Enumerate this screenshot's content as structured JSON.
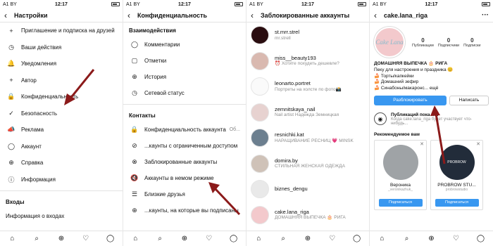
{
  "status": {
    "carrier": "A1 BY",
    "time": "12:17"
  },
  "screen1": {
    "title": "Настройки",
    "items": [
      {
        "icon": "+",
        "label": "Приглашение и подписка на друзей"
      },
      {
        "icon": "◷",
        "label": "Ваши действия"
      },
      {
        "icon": "🔔",
        "label": "Уведомления"
      },
      {
        "icon": "+",
        "label": "Автор"
      },
      {
        "icon": "🔒",
        "label": "Конфиденциальность"
      },
      {
        "icon": "✓",
        "label": "Безопасность"
      },
      {
        "icon": "📣",
        "label": "Реклама"
      },
      {
        "icon": "◯",
        "label": "Аккаунт"
      },
      {
        "icon": "⊕",
        "label": "Справка"
      },
      {
        "icon": "ⓘ",
        "label": "Информация"
      }
    ],
    "section": "Входы",
    "last_item": "Информация о входах"
  },
  "screen2": {
    "title": "Конфиденциальность",
    "section1": "Взаимодействия",
    "items1": [
      {
        "icon": "◯",
        "label": "Комментарии"
      },
      {
        "icon": "▢",
        "label": "Отметки"
      },
      {
        "icon": "⊕",
        "label": "История"
      },
      {
        "icon": "◷",
        "label": "Сетевой статус"
      }
    ],
    "section2": "Контакты",
    "items2": [
      {
        "icon": "🔒",
        "label": "Конфиденциальность аккаунта",
        "value": "Об..."
      },
      {
        "icon": "⊘",
        "label": "...каунты с ограниченным доступом",
        "value": ""
      },
      {
        "icon": "⊗",
        "label": "Заблокированные аккаунты",
        "value": ""
      },
      {
        "icon": "🔇",
        "label": "Аккаунты в немом режиме",
        "value": ""
      },
      {
        "icon": "☰",
        "label": "Близкие друзья",
        "value": ""
      },
      {
        "icon": "⊕",
        "label": "...каунты, на которые вы подписаны",
        "value": ""
      }
    ]
  },
  "screen3": {
    "title": "Заблокированные аккаунты",
    "accounts": [
      {
        "user": "st.mrr.strel",
        "name": "mr.strell"
      },
      {
        "user": "miss__beauty193",
        "name": "⏰ Хотите похудеть дешевле?"
      },
      {
        "user": "leonarto.portret",
        "name": "Портреты на холсте по фото📸"
      },
      {
        "user": "zemnitskaya_nail",
        "name": "Nail artist Надежда Земницкая"
      },
      {
        "user": "resnichki.kat",
        "name": "НАРАЩИВАНИЕ РЕСНИЦ 💗 MINSK"
      },
      {
        "user": "domira.by",
        "name": "СТИЛЬНАЯ ЖЕНСКАЯ ОДЕЖДА"
      },
      {
        "user": "biznes_dengu",
        "name": ""
      },
      {
        "user": "cake.lana_riga",
        "name": "ДОМАШНЯЯ ВЫПЕЧКА 🎂 РИГА"
      }
    ]
  },
  "screen4": {
    "title": "cake.lana_riga",
    "avatar_text": "Cake Lana",
    "stats": [
      {
        "num": "0",
        "label": "Публикации"
      },
      {
        "num": "0",
        "label": "Подписчики"
      },
      {
        "num": "0",
        "label": "Подписки"
      }
    ],
    "bio_name": "ДОМАШНЯЯ ВЫПЕЧКА 🎂 РИГА",
    "bio_lines": [
      "Пеку для настроения и праздника 😊",
      "🍰 Торты/капкейки",
      "🍰 Домашний зефир",
      "🍰 Синабоны/макаронс... ещё"
    ],
    "btn_unblock": "Разблокировать",
    "btn_message": "Написать",
    "no_posts_title": "Публикаций пока нет",
    "no_posts_text": "Когда cake.lana_riga будет участвует что-нибудь...",
    "rec_title": "Рекомендуемое вам",
    "cards": [
      {
        "name": "Вероника",
        "sub": "_veronikazhuk_",
        "btn": "Подписаться"
      },
      {
        "name": "PROBROW STU...",
        "sub": "probrowstudio",
        "btn": "Подписаться",
        "logo": "PROBROW"
      }
    ]
  },
  "tabbar": [
    "⌂",
    "⌕",
    "⊕",
    "♡",
    "◯"
  ]
}
